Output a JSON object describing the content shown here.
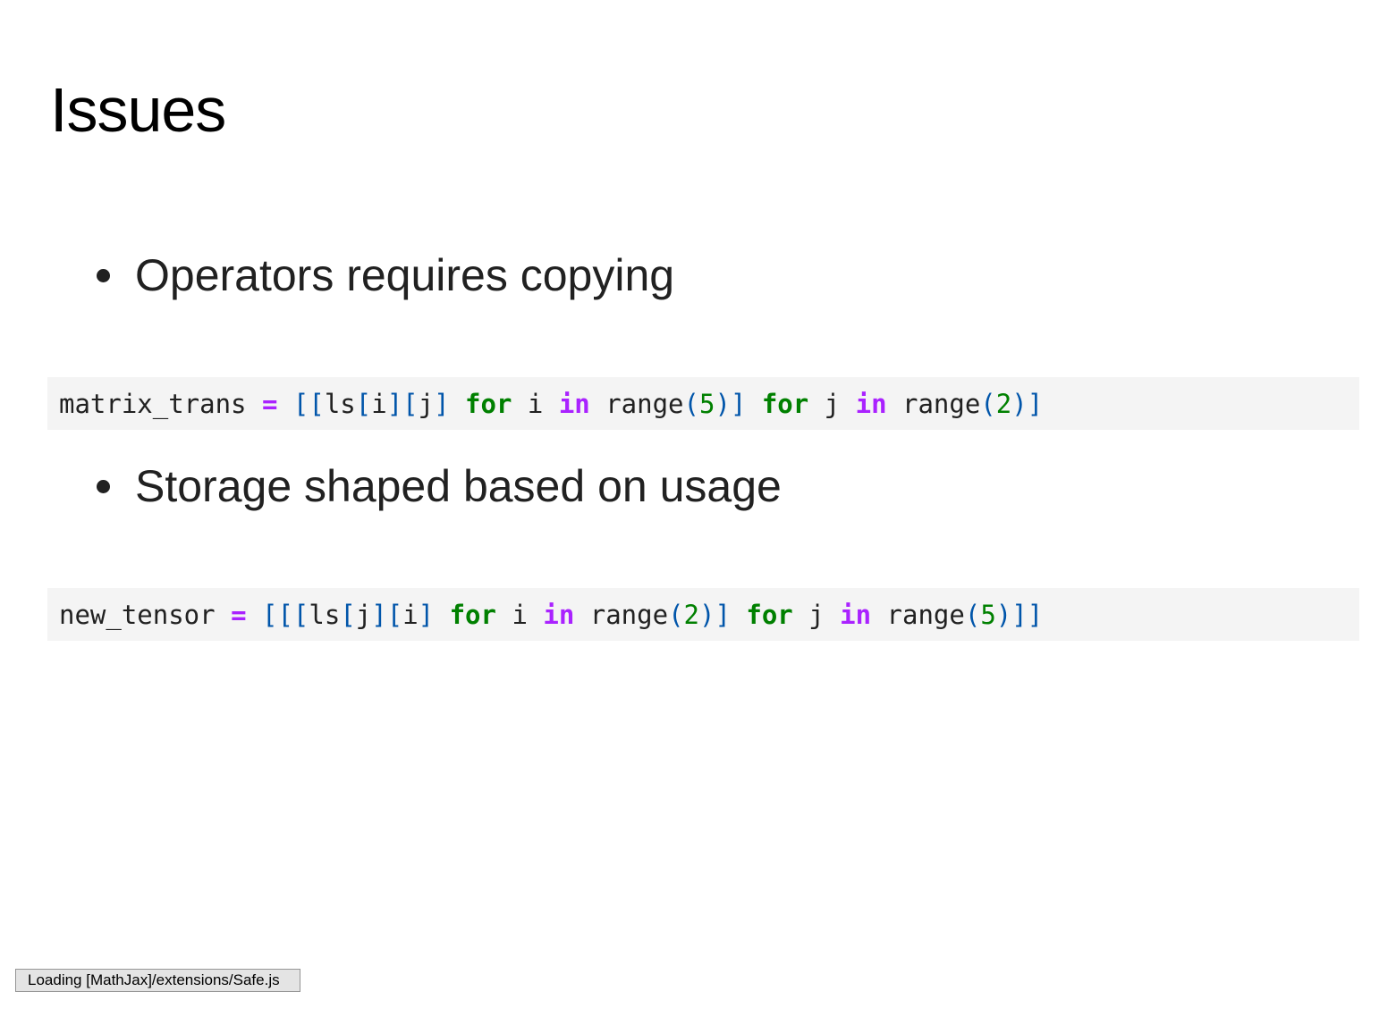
{
  "slide": {
    "title": "Issues"
  },
  "bullets": [
    "Operators requires copying",
    "Storage shaped based on usage"
  ],
  "code_blocks": [
    {
      "line": "matrix_trans = [[ls[i][j] for i in range(5)] for j in range(2)]",
      "tokens": {
        "t0": "matrix_trans",
        "t1": " ",
        "t2": "=",
        "t3": " ",
        "t4": "[[",
        "t5": "ls",
        "t6": "[",
        "t7": "i",
        "t8": "][",
        "t9": "j",
        "t10": "]",
        "t11": " ",
        "t12": "for",
        "t13": " i ",
        "t14": "in",
        "t15": " range",
        "t16": "(",
        "t17": "5",
        "t18": ")]",
        "t19": " ",
        "t20": "for",
        "t21": " j ",
        "t22": "in",
        "t23": " range",
        "t24": "(",
        "t25": "2",
        "t26": ")]"
      }
    },
    {
      "line": "new_tensor = [[[ls[j][i] for i in range(2)] for j in range(5)]]",
      "tokens": {
        "t0": "new_tensor",
        "t1": " ",
        "t2": "=",
        "t3": " ",
        "t4": "[[[",
        "t5": "ls",
        "t6": "[",
        "t7": "j",
        "t8": "][",
        "t9": "i",
        "t10": "]",
        "t11": " ",
        "t12": "for",
        "t13": " i ",
        "t14": "in",
        "t15": " range",
        "t16": "(",
        "t17": "2",
        "t18": ")]",
        "t19": " ",
        "t20": "for",
        "t21": " j ",
        "t22": "in",
        "t23": " range",
        "t24": "(",
        "t25": "5",
        "t26": ")]]"
      }
    }
  ],
  "status": {
    "text": "Loading [MathJax]/extensions/Safe.js"
  },
  "syntax_colors": {
    "operator": "#aa22ff",
    "keyword": "#008000",
    "punctuation": "#0055aa",
    "number": "#008000",
    "name": "#212121",
    "code_background": "#f4f4f4"
  }
}
